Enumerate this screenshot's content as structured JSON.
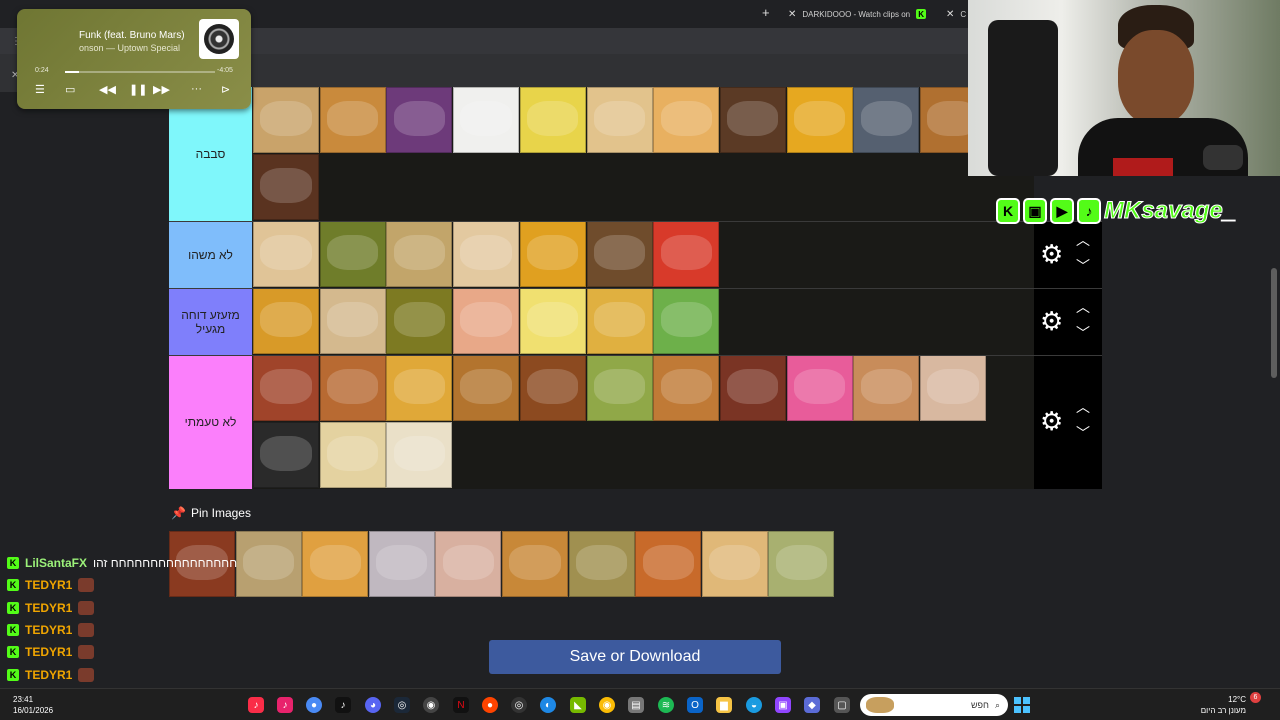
{
  "browser": {
    "tabs": [
      {
        "label": "DARKIDOOO - Watch clips on"
      },
      {
        "label": "C"
      }
    ],
    "new_tab_label": "+"
  },
  "music_player": {
    "title": "Funk (feat. Bruno Mars)",
    "artist": "onson — Uptown Special",
    "elapsed": "0:24",
    "remaining": "-4:05",
    "progress": 0.09
  },
  "tiers": [
    {
      "label": "סבבה",
      "color": "#7ff7fb",
      "tiles": [
        "#c9a36a",
        "#c98a3c",
        "#6d3a7a",
        "#f0f0ee",
        "#e8d44a",
        "#e2c38c",
        "#e8b060",
        "#5b3a25",
        "#e6a820",
        "#556070",
        "#b07030",
        "#5a3320"
      ]
    },
    {
      "label": "לא משהו",
      "color": "#7fbdfb",
      "tiles": [
        "#e0c497",
        "#6f7d2a",
        "#c2a56a",
        "#e3c9a0",
        "#e0a020",
        "#6f4c2c",
        "#d83a2a"
      ]
    },
    {
      "label": "מזעזע דוחה מגעיל",
      "color": "#7f7ffb",
      "tiles": [
        "#d89a28",
        "#d4b98e",
        "#7d7a22",
        "#e8a888",
        "#f0e070",
        "#e0b040",
        "#6db04a"
      ]
    },
    {
      "label": "לא טעמתי",
      "color": "#fb7ffb",
      "tiles": [
        "#a0442a",
        "#b86a32",
        "#e0a838",
        "#b3742e",
        "#8c4a20",
        "#90a848",
        "#c07a36",
        "#7a3424",
        "#e85c9a",
        "#c88c5a",
        "#d8b8a0",
        "#2a2a2a",
        "#e4d2a0",
        "#eae0c8"
      ]
    }
  ],
  "pin_section": {
    "title": "Pin Images",
    "tiles": [
      "#8a3a20",
      "#b8a070",
      "#e0a040",
      "#c0b8c0",
      "#d8b0a0",
      "#c88838",
      "#a09050",
      "#c86a2a",
      "#e0b878",
      "#a8b070"
    ]
  },
  "save_button": "Save or Download",
  "streamer": {
    "handle": "MKsavage_"
  },
  "chat": [
    {
      "user": "LilSantaFX",
      "message": "חחחחחחחחחחחחחחחח זהו",
      "style": "user1"
    },
    {
      "user": "TEDYR1",
      "message": "",
      "style": "user2"
    },
    {
      "user": "TEDYR1",
      "message": "",
      "style": "user2"
    },
    {
      "user": "TEDYR1",
      "message": "",
      "style": "user2"
    },
    {
      "user": "TEDYR1",
      "message": "",
      "style": "user2"
    },
    {
      "user": "TEDYR1",
      "message": "",
      "style": "user2"
    }
  ],
  "taskbar": {
    "time": "23:41",
    "date": "16/01/2026",
    "search_placeholder": "חפש",
    "temperature": "12°C",
    "weather_desc": "מעונן רב היום",
    "notification_count": "6"
  },
  "colors": {
    "accent_kick": "#53fc18",
    "save_button": "#3d5a9e"
  }
}
